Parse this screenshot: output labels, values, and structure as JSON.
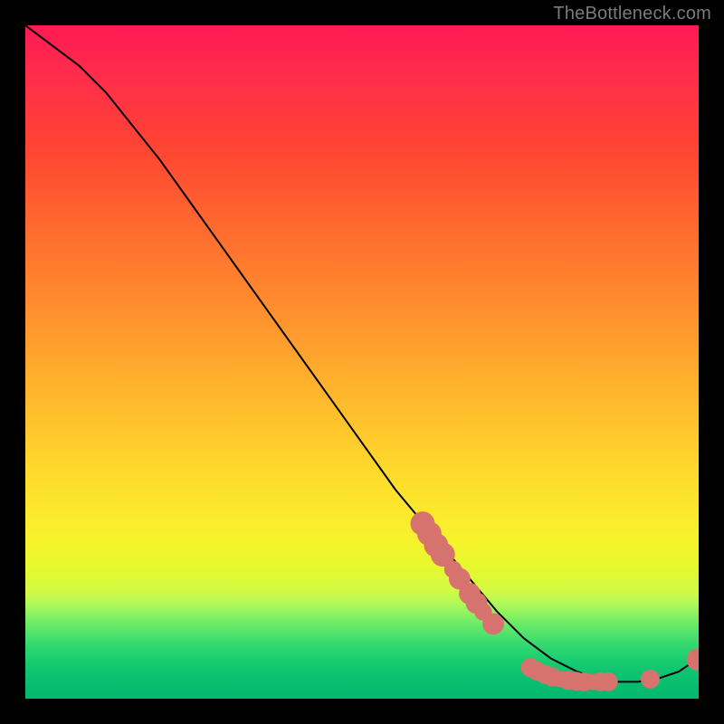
{
  "watermark": "TheBottleneck.com",
  "colors": {
    "background": "#000000",
    "curve": "#000000",
    "marker": "#d6736f",
    "watermark": "#7a7a7a"
  },
  "chart_data": {
    "type": "line",
    "title": "",
    "xlabel": "",
    "ylabel": "",
    "xlim": [
      0,
      100
    ],
    "ylim": [
      0,
      100
    ],
    "grid": false,
    "legend": false,
    "annotations": [
      {
        "text": "TheBottleneck.com",
        "position": "top-right"
      }
    ],
    "series": [
      {
        "name": "curve",
        "x": [
          0,
          4,
          8,
          12,
          16,
          20,
          25,
          30,
          35,
          40,
          45,
          50,
          55,
          60,
          65,
          70,
          74,
          78,
          82,
          85,
          88,
          91,
          94,
          97,
          100
        ],
        "y": [
          100,
          97,
          94,
          90,
          85,
          80,
          73,
          66,
          59,
          52,
          45,
          38,
          31,
          25,
          19,
          13,
          9,
          6,
          4,
          3,
          2.5,
          2.5,
          3,
          4,
          6
        ]
      }
    ],
    "markers": [
      {
        "x": 59,
        "y": 26.0,
        "r": 1.4
      },
      {
        "x": 60,
        "y": 24.5,
        "r": 1.4
      },
      {
        "x": 61,
        "y": 22.8,
        "r": 1.4
      },
      {
        "x": 62,
        "y": 21.4,
        "r": 1.4
      },
      {
        "x": 63.5,
        "y": 19.2,
        "r": 0.9
      },
      {
        "x": 64.5,
        "y": 17.8,
        "r": 1.2
      },
      {
        "x": 66,
        "y": 15.6,
        "r": 1.2
      },
      {
        "x": 67,
        "y": 14.2,
        "r": 1.2
      },
      {
        "x": 68,
        "y": 12.9,
        "r": 0.9
      },
      {
        "x": 69.5,
        "y": 11.1,
        "r": 1.2
      },
      {
        "x": 75.0,
        "y": 4.6,
        "r": 1.0
      },
      {
        "x": 76.0,
        "y": 4.1,
        "r": 1.0
      },
      {
        "x": 77.2,
        "y": 3.6,
        "r": 1.0
      },
      {
        "x": 78.3,
        "y": 3.2,
        "r": 1.0
      },
      {
        "x": 79.5,
        "y": 2.9,
        "r": 0.8
      },
      {
        "x": 80.6,
        "y": 2.7,
        "r": 1.0
      },
      {
        "x": 81.8,
        "y": 2.6,
        "r": 1.0
      },
      {
        "x": 83.0,
        "y": 2.5,
        "r": 1.0
      },
      {
        "x": 84.2,
        "y": 2.5,
        "r": 0.8
      },
      {
        "x": 85.4,
        "y": 2.5,
        "r": 1.0
      },
      {
        "x": 86.6,
        "y": 2.5,
        "r": 1.0
      },
      {
        "x": 92.8,
        "y": 2.9,
        "r": 1.0
      },
      {
        "x": 99.8,
        "y": 5.8,
        "r": 1.2
      }
    ]
  }
}
